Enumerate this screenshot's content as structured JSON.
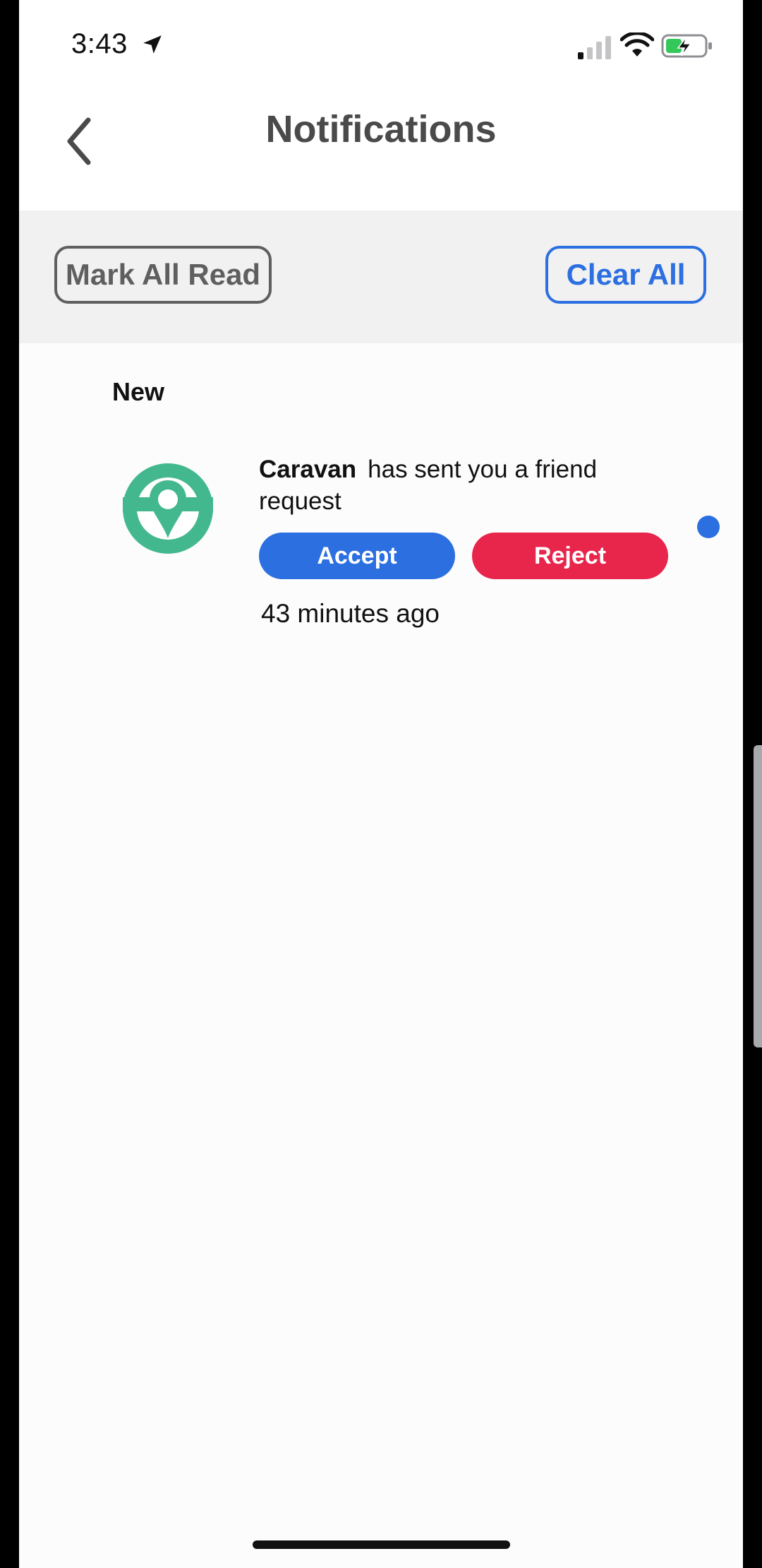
{
  "status_bar": {
    "time": "3:43",
    "icons": [
      "location-arrow-icon",
      "cellular-signal-icon",
      "wifi-icon",
      "battery-charging-icon"
    ]
  },
  "header": {
    "title": "Notifications",
    "back_icon": "chevron-left-icon"
  },
  "toolbar": {
    "mark_all_read_label": "Mark All Read",
    "clear_all_label": "Clear All"
  },
  "section": {
    "label": "New"
  },
  "notifications": [
    {
      "sender": "Caravan",
      "message": "has sent you a friend request",
      "accept_label": "Accept",
      "reject_label": "Reject",
      "time_ago": "43 minutes ago",
      "avatar_icon": "caravan-logo-icon",
      "unread": true
    }
  ],
  "colors": {
    "accent_blue": "#2b6fe0",
    "reject_red": "#e8254b",
    "logo_green": "#43b88f",
    "title_gray": "#4a4a4a",
    "toolbar_bg": "#f1f1f2"
  }
}
